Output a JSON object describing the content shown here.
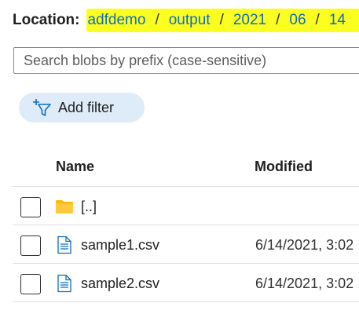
{
  "location": {
    "label": "Location:",
    "path": [
      "adfdemo",
      "output",
      "2021",
      "06",
      "14"
    ],
    "separator": "/",
    "highlight_color": "#fbff1f"
  },
  "search": {
    "placeholder": "Search blobs by prefix (case-sensitive)",
    "value": ""
  },
  "filter": {
    "label": "Add filter",
    "icon": "add-filter-icon"
  },
  "table": {
    "columns": [
      "Name",
      "Modified"
    ],
    "rows": [
      {
        "type": "folder",
        "icon": "folder-icon",
        "name": "[..]",
        "modified": ""
      },
      {
        "type": "file",
        "icon": "file-icon",
        "name": "sample1.csv",
        "modified": "6/14/2021, 3:02"
      },
      {
        "type": "file",
        "icon": "file-icon",
        "name": "sample2.csv",
        "modified": "6/14/2021, 3:02"
      }
    ]
  },
  "colors": {
    "link": "#0f6cbd",
    "filter_pill": "#deecf9",
    "folder": "#ffb900"
  }
}
